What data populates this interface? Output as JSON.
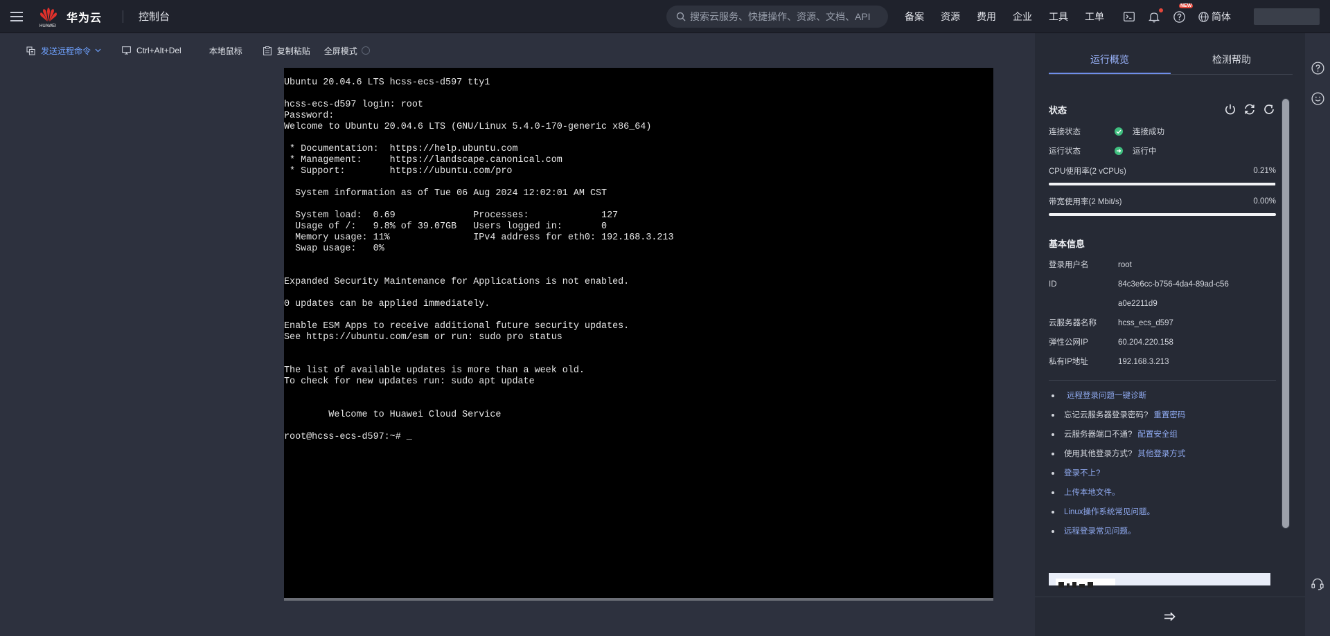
{
  "topbar": {
    "brand": "华为云",
    "brand_small": "HUAWEI",
    "console": "控制台",
    "search_placeholder": "搜索云服务、快捷操作、资源、文档、API",
    "links": [
      "备案",
      "资源",
      "费用",
      "企业",
      "工具",
      "工单"
    ],
    "new_badge": "NEW",
    "language": "简体"
  },
  "toolbar": {
    "send_remote_cmd": "发送远程命令",
    "ctrl_alt_del": "Ctrl+Alt+Del",
    "local_mouse": "本地鼠标",
    "copy_paste": "复制粘贴",
    "fullscreen": "全屏模式"
  },
  "terminal": {
    "lines": [
      "Ubuntu 20.04.6 LTS hcss-ecs-d597 tty1",
      "",
      "hcss-ecs-d597 login: root",
      "Password:",
      "Welcome to Ubuntu 20.04.6 LTS (GNU/Linux 5.4.0-170-generic x86_64)",
      "",
      " * Documentation:  https://help.ubuntu.com",
      " * Management:     https://landscape.canonical.com",
      " * Support:        https://ubuntu.com/pro",
      "",
      "  System information as of Tue 06 Aug 2024 12:02:01 AM CST",
      "",
      "  System load:  0.69              Processes:             127",
      "  Usage of /:   9.8% of 39.07GB   Users logged in:       0",
      "  Memory usage: 11%               IPv4 address for eth0: 192.168.3.213",
      "  Swap usage:   0%",
      "",
      "",
      "Expanded Security Maintenance for Applications is not enabled.",
      "",
      "0 updates can be applied immediately.",
      "",
      "Enable ESM Apps to receive additional future security updates.",
      "See https://ubuntu.com/esm or run: sudo pro status",
      "",
      "",
      "The list of available updates is more than a week old.",
      "To check for new updates run: sudo apt update",
      "",
      "",
      "        Welcome to Huawei Cloud Service",
      "",
      "root@hcss-ecs-d597:~# _"
    ]
  },
  "panel": {
    "tabs": [
      "运行概览",
      "检测帮助"
    ],
    "status_title": "状态",
    "conn_label": "连接状态",
    "conn_value": "连接成功",
    "run_label": "运行状态",
    "run_value": "运行中",
    "cpu_label": "CPU使用率(2 vCPUs)",
    "cpu_value": "0.21%",
    "cpu_fraction": 0.0021,
    "bw_label": "带宽使用率(2 Mbit/s)",
    "bw_value": "0.00%",
    "bw_fraction": 0.0,
    "basic_title": "基本信息",
    "info": [
      {
        "k": "登录用户名",
        "v": "root"
      },
      {
        "k": "ID",
        "v": "84c3e6cc-b756-4da4-89ad-c56a0e2211d9"
      },
      {
        "k": "云服务器名称",
        "v": "hcss_ecs_d597"
      },
      {
        "k": "弹性公网IP",
        "v": "60.204.220.158"
      },
      {
        "k": "私有IP地址",
        "v": "192.168.3.213"
      }
    ],
    "help": [
      {
        "pre": "",
        "link": "远程登录问题一键诊断"
      },
      {
        "pre": "忘记云服务器登录密码?",
        "link": "重置密码"
      },
      {
        "pre": "云服务器端口不通?",
        "link": "配置安全组"
      },
      {
        "pre": "使用其他登录方式?",
        "link": "其他登录方式"
      },
      {
        "pre": "",
        "link": "登录不上?"
      },
      {
        "pre": "",
        "link": "上传本地文件。"
      },
      {
        "pre": "",
        "link": "Linux操作系统常见问题。"
      },
      {
        "pre": "",
        "link": "远程登录常见问题。"
      }
    ]
  },
  "colors": {
    "accent": "#6fa2ff",
    "link": "#8fa9ef",
    "ok": "#3fbf7f",
    "panel_bg": "#262a35",
    "terminal_bg": "#000000"
  }
}
